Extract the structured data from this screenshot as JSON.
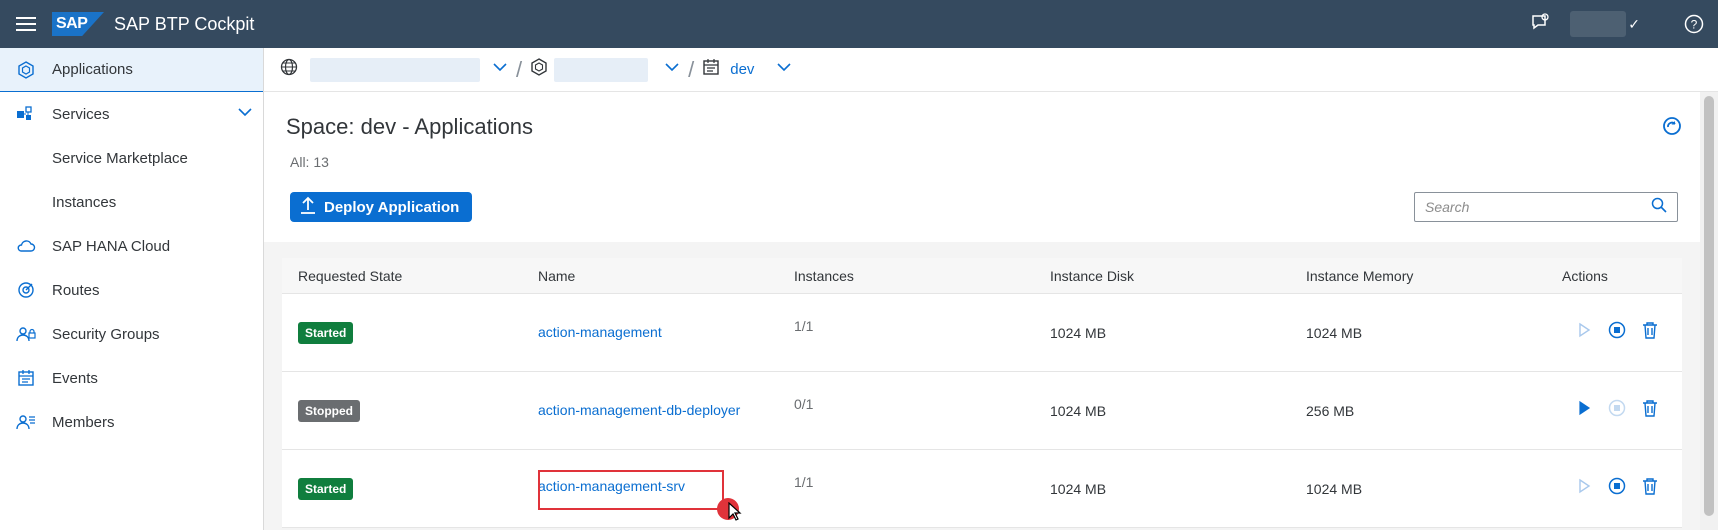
{
  "shell": {
    "logo": "SAP",
    "title": "SAP BTP Cockpit",
    "user_check": "✓"
  },
  "sidebar": {
    "items": [
      {
        "label": "Applications",
        "icon": "applications-icon"
      },
      {
        "label": "Services",
        "icon": "services-icon"
      },
      {
        "label": "Service Marketplace"
      },
      {
        "label": "Instances"
      },
      {
        "label": "SAP HANA Cloud",
        "icon": "cloud-icon"
      },
      {
        "label": "Routes",
        "icon": "routes-icon"
      },
      {
        "label": "Security Groups",
        "icon": "security-groups-icon"
      },
      {
        "label": "Events",
        "icon": "events-icon"
      },
      {
        "label": "Members",
        "icon": "members-icon"
      }
    ]
  },
  "breadcrumb": {
    "space": "dev"
  },
  "page": {
    "title": "Space: dev - Applications",
    "count": "All: 13",
    "deploy_label": "Deploy Application",
    "search_placeholder": "Search"
  },
  "table": {
    "headers": [
      "Requested State",
      "Name",
      "Instances",
      "Instance Disk",
      "Instance Memory",
      "Actions"
    ],
    "rows": [
      {
        "state": "Started",
        "name": "action-management",
        "instances": "1/1",
        "disk": "1024 MB",
        "memory": "1024 MB"
      },
      {
        "state": "Stopped",
        "name": "action-management-db-deployer",
        "instances": "0/1",
        "disk": "1024 MB",
        "memory": "256 MB"
      },
      {
        "state": "Started",
        "name": "action-management-srv",
        "instances": "1/1",
        "disk": "1024 MB",
        "memory": "1024 MB"
      }
    ]
  },
  "colors": {
    "shell": "#354a5f",
    "accent": "#0a6ed1",
    "started": "#107e3e",
    "stopped": "#6a6d70",
    "highlight": "#e0333a"
  }
}
